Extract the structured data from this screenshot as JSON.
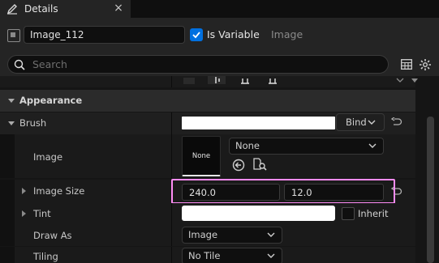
{
  "tab": {
    "title": "Details",
    "close": "×"
  },
  "widget": {
    "name": "Image_112",
    "is_variable_label": "Is Variable",
    "is_variable_checked": true,
    "type": "Image"
  },
  "search": {
    "placeholder": "Search"
  },
  "sections": {
    "appearance": "Appearance"
  },
  "brush": {
    "label": "Brush",
    "bind_label": "Bind",
    "image_label": "Image",
    "thumbnail_text": "None",
    "image_value": "None",
    "image_size_label": "Image Size",
    "size_x": "240.0",
    "size_y": "12.0",
    "tint_label": "Tint",
    "inherit_label": "Inherit",
    "draw_as_label": "Draw As",
    "draw_as_value": "Image",
    "tiling_label": "Tiling",
    "tiling_value": "No Tile"
  },
  "colors": {
    "accent": "#0070e0",
    "highlight": "#ff8cf5"
  }
}
